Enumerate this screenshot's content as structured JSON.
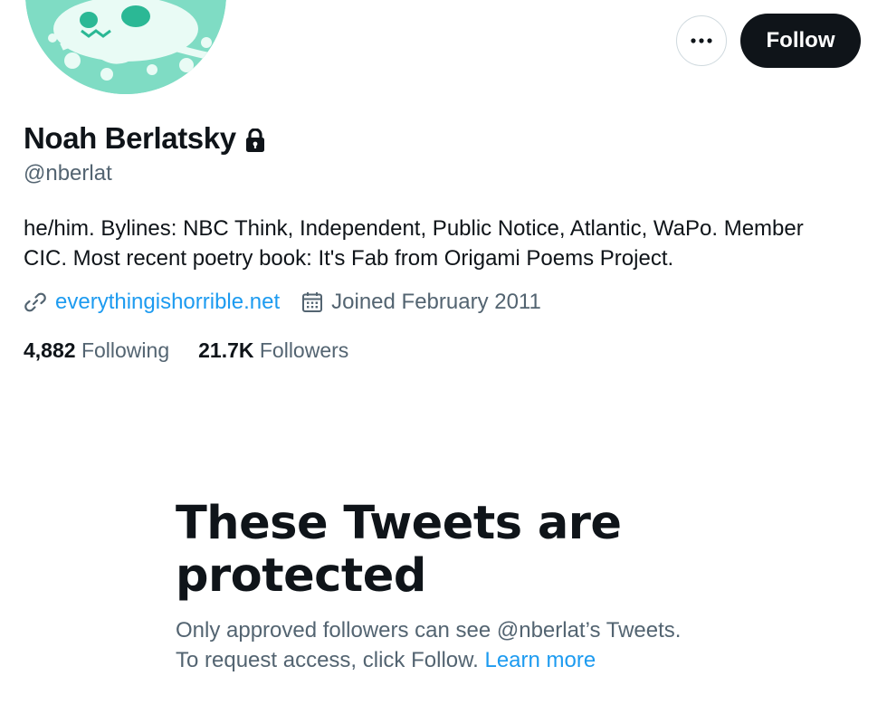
{
  "header": {
    "more_icon": "ellipsis-icon",
    "follow_label": "Follow"
  },
  "profile": {
    "name": "Noah Berlatsky",
    "protected_icon": "lock-icon",
    "handle": "@nberlat",
    "bio_line1": "he/him. Bylines: NBC Think, Independent, Public Notice, Atlantic, WaPo. Member",
    "bio_line2": "CIC. Most recent poetry book: It's Fab from Origami Poems Project.",
    "website": {
      "icon": "link-icon",
      "text": "everythingishorrible.net"
    },
    "joined": {
      "icon": "calendar-icon",
      "text": "Joined February 2011"
    },
    "stats": {
      "following_count": "4,882",
      "following_label": "Following",
      "followers_count": "21.7K",
      "followers_label": "Followers"
    }
  },
  "protected_notice": {
    "title_line1": "These Tweets are",
    "title_line2": "protected",
    "line1": "Only approved followers can see @nberlat’s Tweets.",
    "line2_prefix": "To request access, click Follow.",
    "learn_more": "Learn more"
  },
  "colors": {
    "accent": "#1d9bf0",
    "text_primary": "#0f1419",
    "text_secondary": "#536471",
    "avatar_bg": "#7fdcc4",
    "follow_bg": "#0f1419"
  }
}
